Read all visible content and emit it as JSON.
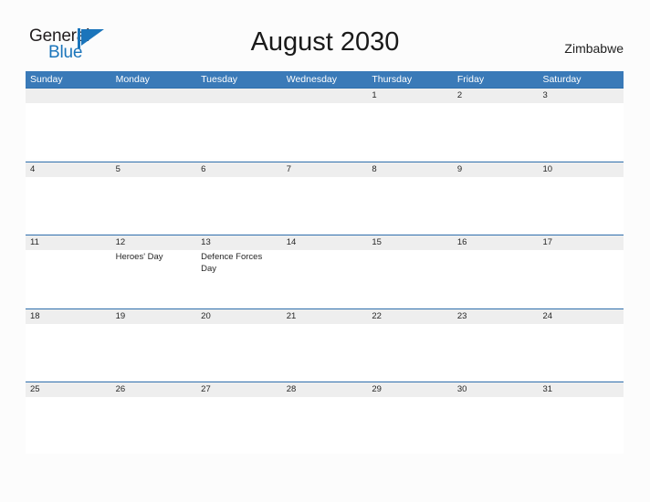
{
  "brand": {
    "name_part1": "General",
    "name_part2": "Blue",
    "mark_icon": "blue-triangle-flag-icon",
    "color_dark": "#231f20",
    "color_blue": "#1b75bb"
  },
  "header": {
    "title": "August 2030",
    "country": "Zimbabwe"
  },
  "theme": {
    "header_blue": "#3a7ab8",
    "date_band_grey": "#eeeeee",
    "row_rule_blue": "#2f6fad",
    "page_background": "#fcfcfc",
    "text_color": "#262626"
  },
  "calendar": {
    "weekdays": [
      "Sunday",
      "Monday",
      "Tuesday",
      "Wednesday",
      "Thursday",
      "Friday",
      "Saturday"
    ],
    "weeks": [
      {
        "days": [
          {
            "num": "",
            "event": ""
          },
          {
            "num": "",
            "event": ""
          },
          {
            "num": "",
            "event": ""
          },
          {
            "num": "",
            "event": ""
          },
          {
            "num": "1",
            "event": ""
          },
          {
            "num": "2",
            "event": ""
          },
          {
            "num": "3",
            "event": ""
          }
        ]
      },
      {
        "days": [
          {
            "num": "4",
            "event": ""
          },
          {
            "num": "5",
            "event": ""
          },
          {
            "num": "6",
            "event": ""
          },
          {
            "num": "7",
            "event": ""
          },
          {
            "num": "8",
            "event": ""
          },
          {
            "num": "9",
            "event": ""
          },
          {
            "num": "10",
            "event": ""
          }
        ]
      },
      {
        "days": [
          {
            "num": "11",
            "event": ""
          },
          {
            "num": "12",
            "event": "Heroes' Day"
          },
          {
            "num": "13",
            "event": "Defence Forces Day"
          },
          {
            "num": "14",
            "event": ""
          },
          {
            "num": "15",
            "event": ""
          },
          {
            "num": "16",
            "event": ""
          },
          {
            "num": "17",
            "event": ""
          }
        ]
      },
      {
        "days": [
          {
            "num": "18",
            "event": ""
          },
          {
            "num": "19",
            "event": ""
          },
          {
            "num": "20",
            "event": ""
          },
          {
            "num": "21",
            "event": ""
          },
          {
            "num": "22",
            "event": ""
          },
          {
            "num": "23",
            "event": ""
          },
          {
            "num": "24",
            "event": ""
          }
        ]
      },
      {
        "days": [
          {
            "num": "25",
            "event": ""
          },
          {
            "num": "26",
            "event": ""
          },
          {
            "num": "27",
            "event": ""
          },
          {
            "num": "28",
            "event": ""
          },
          {
            "num": "29",
            "event": ""
          },
          {
            "num": "30",
            "event": ""
          },
          {
            "num": "31",
            "event": ""
          }
        ]
      }
    ]
  }
}
